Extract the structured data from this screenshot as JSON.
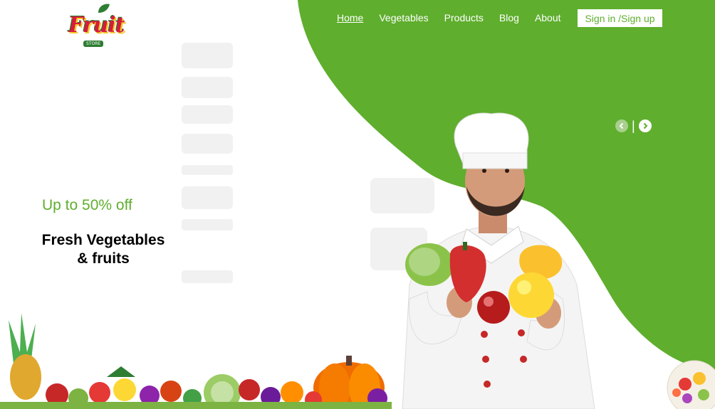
{
  "brand": {
    "logo_word": "Fruit",
    "logo_sub": "STORE"
  },
  "nav": {
    "items": [
      {
        "label": "Home",
        "active": true
      },
      {
        "label": "Vegetables"
      },
      {
        "label": "Products"
      },
      {
        "label": "Blog"
      },
      {
        "label": "About"
      }
    ],
    "signin_label": "Sign in /Sign up"
  },
  "carousel": {
    "separator": "|",
    "prev_icon": "chevron-left-icon",
    "next_icon": "chevron-right-icon"
  },
  "hero": {
    "offer": "Up to 50% off",
    "headline_line1": "Fresh Vegetables",
    "headline_line2": "& fruits"
  },
  "colors": {
    "accent_green": "#5fae2e",
    "white": "#ffffff",
    "text": "#000000"
  }
}
